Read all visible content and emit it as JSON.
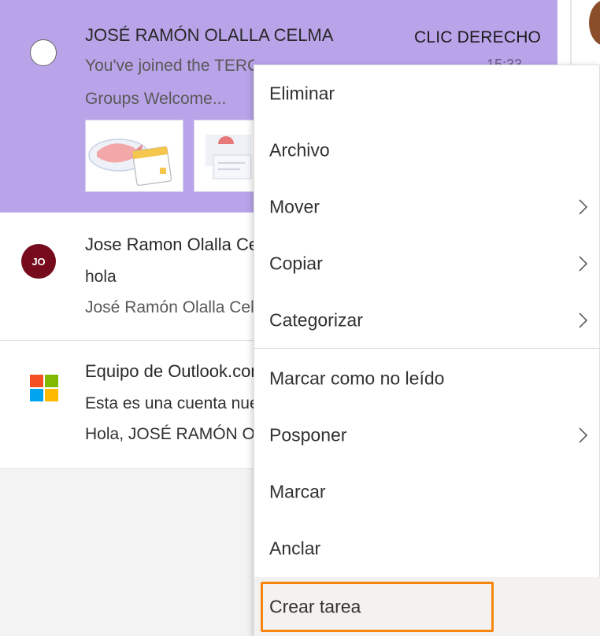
{
  "annotation": {
    "label": "CLIC DERECHO",
    "highlight_color": "#f7850e"
  },
  "messages": [
    {
      "sender": "JOSÉ RAMÓN OLALLA CELMA",
      "preview1": "You've joined the TERCERO...",
      "time": "15:33",
      "preview2": "Groups Welcome...",
      "selected": true,
      "bg_color": "#b9a4ea"
    },
    {
      "avatar_initials": "JO",
      "avatar_color": "#750b1c",
      "sender": "Jose Ramon Olalla Celma",
      "preview1": "hola",
      "preview2": "José Ramón Olalla Celma"
    },
    {
      "sender": "Equipo de Outlook.com",
      "preview1": "Esta es una cuenta nueva",
      "preview2": "Hola, JOSÉ RAMÓN OLALLA",
      "logo": "microsoft-logo"
    }
  ],
  "context_menu": {
    "items": [
      {
        "label": "Eliminar",
        "submenu": false
      },
      {
        "label": "Archivo",
        "submenu": false
      },
      {
        "label": "Mover",
        "submenu": true
      },
      {
        "label": "Copiar",
        "submenu": true
      },
      {
        "label": "Categorizar",
        "submenu": true
      },
      {
        "label": "Marcar como no leído",
        "submenu": false
      },
      {
        "label": "Posponer",
        "submenu": true
      },
      {
        "label": "Marcar",
        "submenu": false
      },
      {
        "label": "Anclar",
        "submenu": false
      },
      {
        "label": "Crear tarea",
        "submenu": false,
        "highlighted": true
      }
    ],
    "chevron_icon": "chevron-right-icon"
  }
}
